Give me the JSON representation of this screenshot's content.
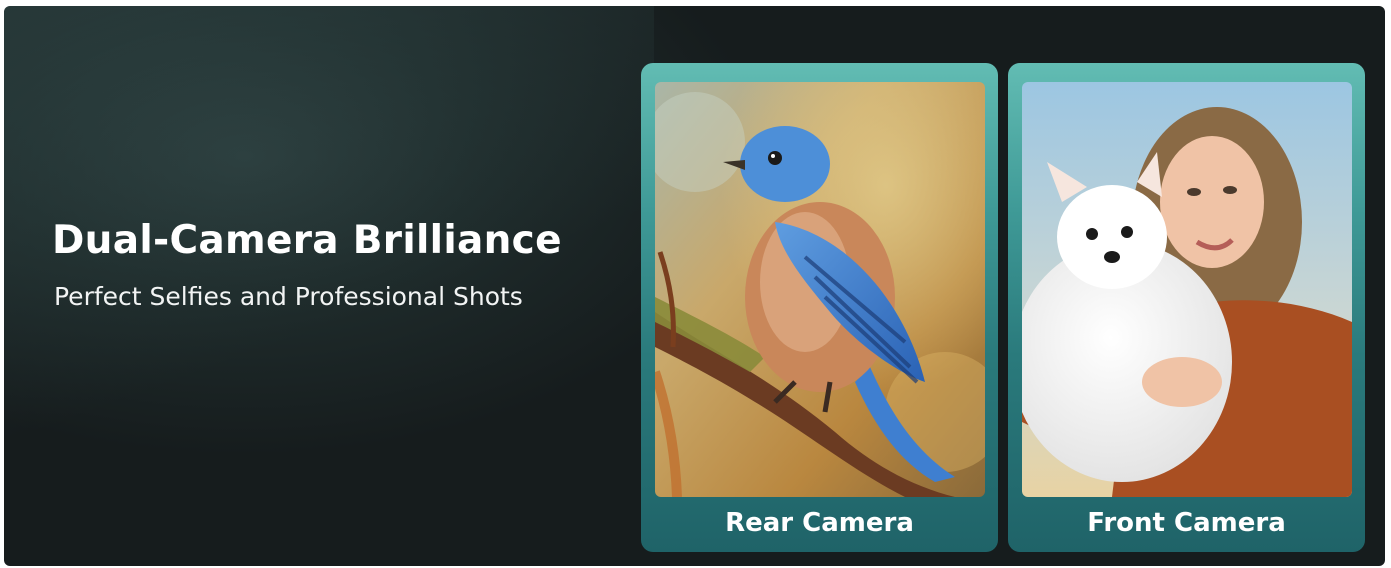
{
  "hero": {
    "title": "Dual-Camera Brilliance",
    "subtitle": "Perfect Selfies and Professional Shots"
  },
  "cards": [
    {
      "label": "Rear Camera",
      "image": "bluebird-on-branch-photo"
    },
    {
      "label": "Front Camera",
      "image": "woman-holding-white-pomeranian-photo"
    }
  ],
  "colors": {
    "background": "#161c1d",
    "card_accent": "#62bcb3",
    "text": "#ffffff"
  }
}
